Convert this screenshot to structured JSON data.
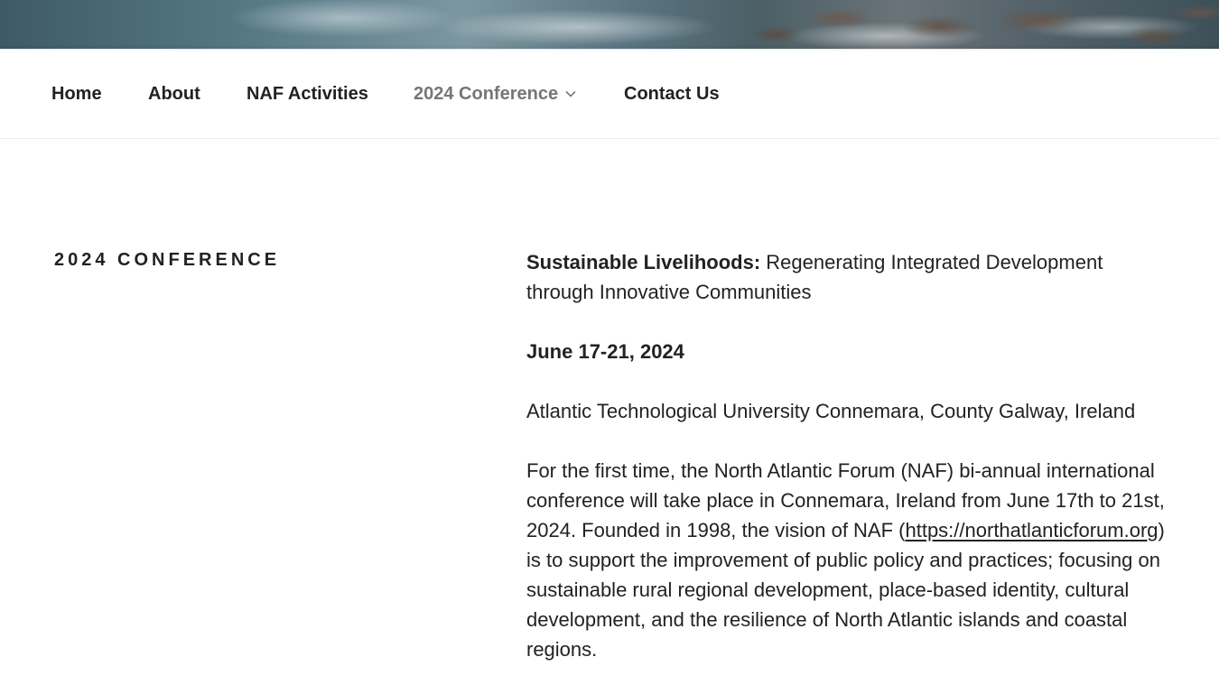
{
  "nav": {
    "items": [
      {
        "label": "Home"
      },
      {
        "label": "About"
      },
      {
        "label": "NAF Activities"
      },
      {
        "label": "2024 Conference"
      },
      {
        "label": "Contact Us"
      }
    ]
  },
  "page": {
    "title": "2024 CONFERENCE"
  },
  "content": {
    "theme_label": "Sustainable Livelihoods:",
    "theme_text": "Regenerating Integrated Development through Innovative Communities",
    "dates": "June 17-21, 2024",
    "location": "Atlantic Technological University Connemara, County Galway, Ireland",
    "description_before": "For the first time, the North Atlantic Forum (NAF) bi-annual international conference will take place in Connemara, Ireland from June 17th to 21st, 2024. Founded in 1998, the vision of NAF (",
    "description_link": "https://northatlanticforum.org",
    "description_after": ") is to support the improvement of public policy and practices; focusing on sustainable rural regional development, place-based identity, cultural development, and the resilience of North Atlantic islands and coastal regions."
  }
}
